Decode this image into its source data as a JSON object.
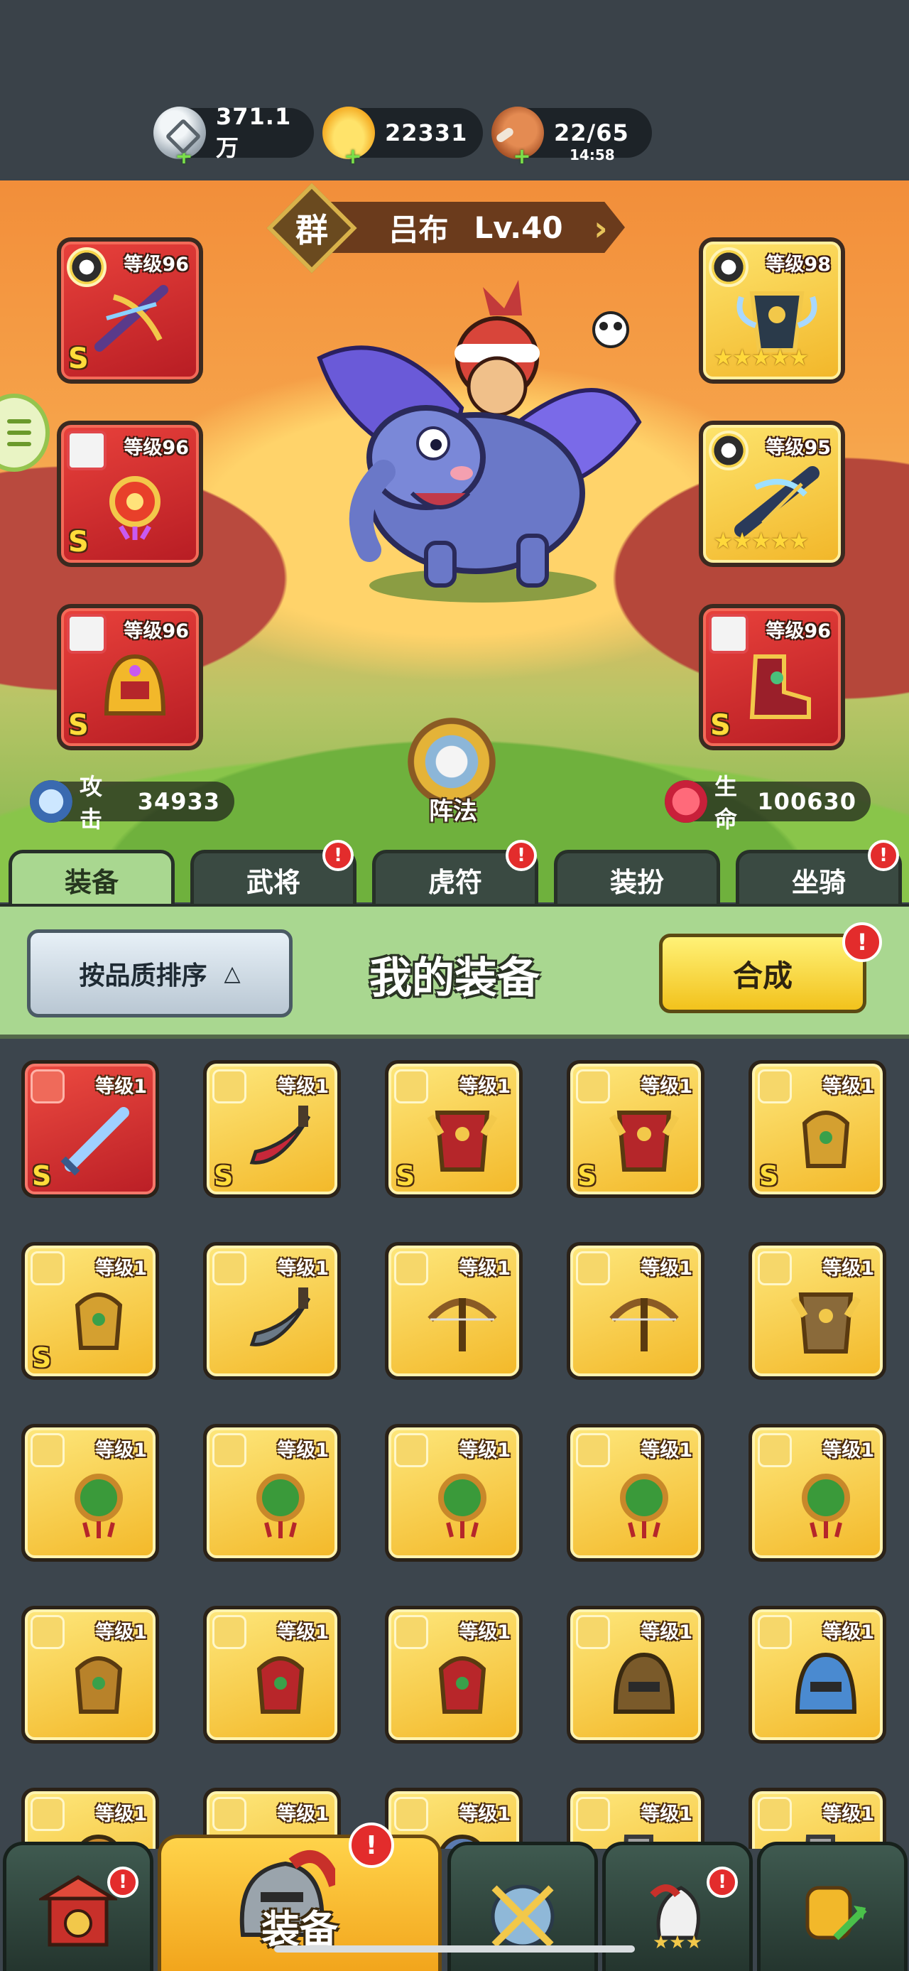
{
  "resources": [
    {
      "name": "coin-icon",
      "value": "371.1万",
      "sub": ""
    },
    {
      "name": "gold-ingot-icon",
      "value": "22331",
      "sub": ""
    },
    {
      "name": "meat-icon",
      "value": "22/65",
      "sub": "14:58"
    }
  ],
  "hero": {
    "faction": "群",
    "name": "吕布",
    "level": "Lv.40",
    "formation_label": "阵法",
    "attack_label": "攻击",
    "attack_value": "34933",
    "hp_label": "生命",
    "hp_value": "100630"
  },
  "equipped": {
    "left": [
      {
        "level": "等级96",
        "rank": "S",
        "type_icon": "yin-yang-icon",
        "art": "crossbow-icon"
      },
      {
        "level": "等级96",
        "rank": "S",
        "type_icon": "medal-icon",
        "art": "amulet-icon"
      },
      {
        "level": "等级96",
        "rank": "S",
        "type_icon": "helmet-icon",
        "art": "helmet-icon"
      }
    ],
    "right": [
      {
        "level": "等级98",
        "stars": "★★★★★",
        "type_icon": "yin-yang-icon",
        "art": "armor-icon"
      },
      {
        "level": "等级95",
        "stars": "★★★★★",
        "type_icon": "yin-yang-icon",
        "art": "blade-icon"
      },
      {
        "level": "等级96",
        "rank": "S",
        "type_icon": "boot-icon",
        "art": "boots-icon"
      }
    ]
  },
  "tabs": [
    {
      "label": "装备",
      "active": true,
      "badge": false
    },
    {
      "label": "武将",
      "active": false,
      "badge": true
    },
    {
      "label": "虎符",
      "active": false,
      "badge": true
    },
    {
      "label": "装扮",
      "active": false,
      "badge": false
    },
    {
      "label": "坐骑",
      "active": false,
      "badge": true
    }
  ],
  "badge_text": "!",
  "panel": {
    "sort_label": "按品质排序",
    "sort_arrow": "△",
    "title": "我的装备",
    "synth_label": "合成"
  },
  "items": [
    {
      "level": "等级1",
      "rank": "S",
      "red": true,
      "art": "sword-icon",
      "color": "#9fd0ff"
    },
    {
      "level": "等级1",
      "rank": "S",
      "red": false,
      "art": "saber-icon",
      "color": "#c8283a"
    },
    {
      "level": "等级1",
      "rank": "S",
      "red": false,
      "art": "armor-icon",
      "color": "#b5262a"
    },
    {
      "level": "等级1",
      "rank": "S",
      "red": false,
      "art": "armor-icon",
      "color": "#b5262a"
    },
    {
      "level": "等级1",
      "rank": "S",
      "red": false,
      "art": "gauntlet-icon",
      "color": "#d4a030"
    },
    {
      "level": "等级1",
      "rank": "S",
      "red": false,
      "art": "gauntlet-icon",
      "color": "#d4a030"
    },
    {
      "level": "等级1",
      "rank": "",
      "red": false,
      "art": "saber-icon",
      "color": "#6b7a88"
    },
    {
      "level": "等级1",
      "rank": "",
      "red": false,
      "art": "crossbow-icon",
      "color": "#8a5a24"
    },
    {
      "level": "等级1",
      "rank": "",
      "red": false,
      "art": "crossbow-icon",
      "color": "#8a5a24"
    },
    {
      "level": "等级1",
      "rank": "",
      "red": false,
      "art": "armor-icon",
      "color": "#8a6a3a"
    },
    {
      "level": "等级1",
      "rank": "",
      "red": false,
      "art": "amulet-icon",
      "color": "#3a9a3a"
    },
    {
      "level": "等级1",
      "rank": "",
      "red": false,
      "art": "amulet-icon",
      "color": "#3a9a3a"
    },
    {
      "level": "等级1",
      "rank": "",
      "red": false,
      "art": "amulet-icon",
      "color": "#3a9a3a"
    },
    {
      "level": "等级1",
      "rank": "",
      "red": false,
      "art": "amulet-icon",
      "color": "#3a9a3a"
    },
    {
      "level": "等级1",
      "rank": "",
      "red": false,
      "art": "amulet-icon",
      "color": "#3a9a3a"
    },
    {
      "level": "等级1",
      "rank": "",
      "red": false,
      "art": "gauntlet-icon",
      "color": "#b8822a"
    },
    {
      "level": "等级1",
      "rank": "",
      "red": false,
      "art": "gauntlet-icon",
      "color": "#b8262a"
    },
    {
      "level": "等级1",
      "rank": "",
      "red": false,
      "art": "gauntlet-icon",
      "color": "#b8262a"
    },
    {
      "level": "等级1",
      "rank": "",
      "red": false,
      "art": "helmet-icon",
      "color": "#7a5a2a"
    },
    {
      "level": "等级1",
      "rank": "",
      "red": false,
      "art": "helmet-icon",
      "color": "#4a8ad0"
    },
    {
      "level": "等级1",
      "rank": "",
      "red": false,
      "art": "helmet-icon",
      "color": "#c8882a"
    },
    {
      "level": "等级1",
      "rank": "",
      "red": false,
      "art": "helmet-icon",
      "color": "#c8882a"
    },
    {
      "level": "等级1",
      "rank": "",
      "red": false,
      "art": "helmet-icon",
      "color": "#5a7ab0"
    },
    {
      "level": "等级1",
      "rank": "",
      "red": false,
      "art": "boots-icon",
      "color": "#a0a0a0"
    },
    {
      "level": "等级1",
      "rank": "",
      "red": false,
      "art": "boots-icon",
      "color": "#a0a0a0"
    }
  ],
  "bottom_nav": [
    {
      "name": "nav-city",
      "label": "",
      "icon": "gate-icon",
      "badge": true
    },
    {
      "name": "nav-equipment",
      "label": "装备",
      "icon": "helmet-icon",
      "badge": true
    },
    {
      "name": "nav-battle",
      "label": "",
      "icon": "crossed-swords-icon",
      "badge": false
    },
    {
      "name": "nav-heroes",
      "label": "",
      "icon": "hero-icon",
      "badge": true
    },
    {
      "name": "nav-upgrade",
      "label": "",
      "icon": "fist-icon",
      "badge": false
    }
  ]
}
